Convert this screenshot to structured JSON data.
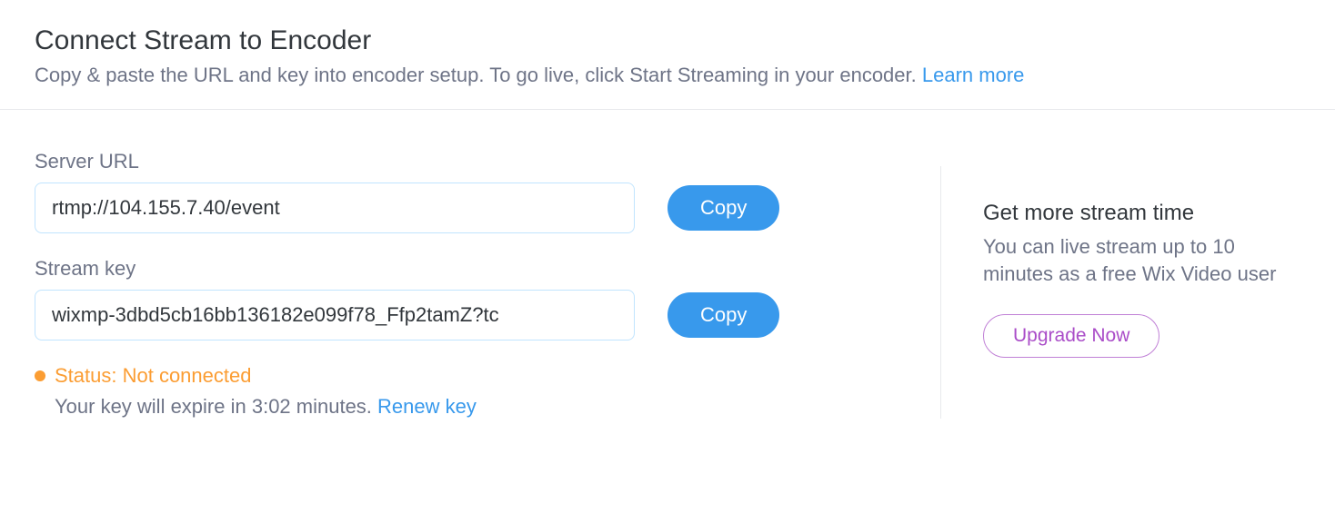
{
  "header": {
    "title": "Connect Stream to Encoder",
    "subtitle": "Copy & paste the URL and key into encoder setup. To go live, click Start Streaming in your encoder. ",
    "learn_more": "Learn more"
  },
  "server_url": {
    "label": "Server URL",
    "value": "rtmp://104.155.7.40/event",
    "copy_label": "Copy"
  },
  "stream_key": {
    "label": "Stream key",
    "value": "wixmp-3dbd5cb16bb136182e099f78_Ffp2tamZ?tc",
    "copy_label": "Copy"
  },
  "status": {
    "text": "Status: Not connected",
    "expire_text": "Your key will expire in 3:02 minutes. ",
    "renew_label": "Renew key"
  },
  "upsell": {
    "title": "Get more stream time",
    "text": "You can live stream up to 10 minutes as a free Wix Video user",
    "button_label": "Upgrade Now"
  }
}
